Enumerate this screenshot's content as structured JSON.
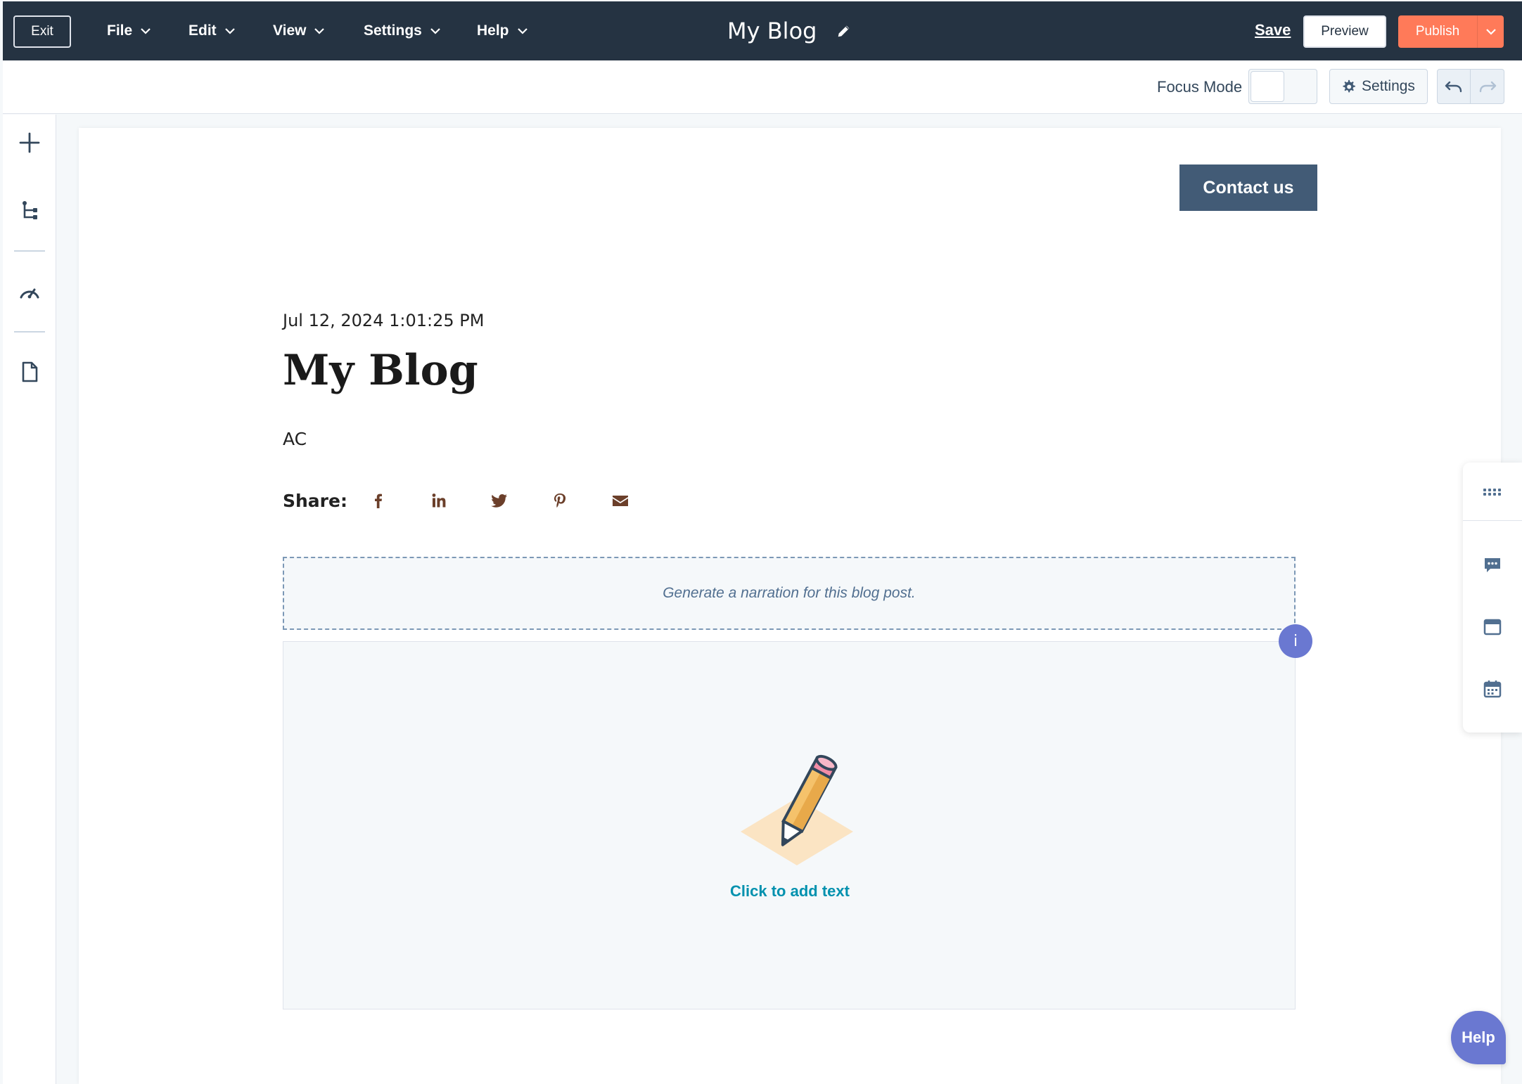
{
  "topbar": {
    "exit_label": "Exit",
    "menus": [
      {
        "label": "File"
      },
      {
        "label": "Edit"
      },
      {
        "label": "View"
      },
      {
        "label": "Settings"
      },
      {
        "label": "Help"
      }
    ],
    "doc_title": "My Blog",
    "save_label": "Save",
    "preview_label": "Preview",
    "publish_label": "Publish"
  },
  "toolbar": {
    "focus_mode_label": "Focus Mode",
    "focus_mode_on": false,
    "settings_label": "Settings"
  },
  "left_rail": {
    "items": [
      "add-icon",
      "tree-structure-icon",
      "speedometer-icon",
      "document-icon"
    ]
  },
  "page": {
    "contact_button": "Contact us",
    "post_date": "Jul 12, 2024 1:01:25 PM",
    "post_title": "My Blog",
    "post_author": "AC",
    "share_label": "Share:",
    "share_icons": [
      "facebook-icon",
      "linkedin-icon",
      "twitter-icon",
      "pinterest-icon",
      "email-icon"
    ],
    "narration_text": "Generate a narration for this blog post.",
    "info_badge": "i",
    "add_text_label": "Click to add text"
  },
  "right_rail": {
    "items": [
      "grid-dots-icon",
      "chat-icon",
      "inbox-icon",
      "calendar-icon"
    ]
  },
  "help_fab": "Help",
  "colors": {
    "topbar_bg": "#253342",
    "publish": "#ff7a59",
    "contact_btn": "#425b76",
    "accent_teal": "#0091ae",
    "info_purple": "#6a78d1",
    "share_icon": "#6b3f2a"
  }
}
